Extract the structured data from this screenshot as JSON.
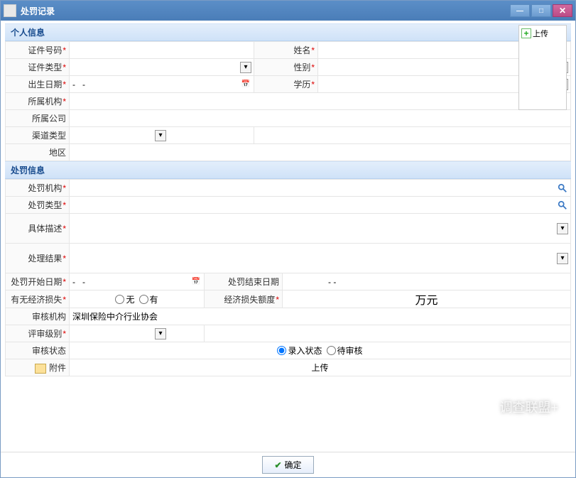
{
  "window": {
    "title": "处罚记录"
  },
  "sections": {
    "personal": "个人信息",
    "punish": "处罚信息"
  },
  "labels": {
    "idnum": "证件号码",
    "name": "姓名",
    "idtype": "证件类型",
    "gender": "性别",
    "dob": "出生日期",
    "edu": "学历",
    "org": "所属机构",
    "company": "所属公司",
    "channel": "渠道类型",
    "region": "地区",
    "punishOrg": "处罚机构",
    "punishType": "处罚类型",
    "desc": "具体描述",
    "result": "处理结果",
    "startDate": "处罚开始日期",
    "endDate": "处罚结束日期",
    "hasLoss": "有无经济损失",
    "lossAmt": "经济损失额度",
    "auditOrg": "审核机构",
    "auditLevel": "评审级别",
    "auditStatus": "审核状态",
    "attach": "附件"
  },
  "values": {
    "dob": "-   -",
    "startDate": "-   -",
    "endDate": "-   -",
    "auditOrg": "深圳保险中介行业协会",
    "lossUnit": "万元"
  },
  "radios": {
    "lossNone": "无",
    "lossHas": "有",
    "statusEntry": "录入状态",
    "statusPending": "待审核"
  },
  "buttons": {
    "upload": "上传",
    "uploadAction": "上传",
    "ok": "确定"
  },
  "watermark": "调查联盟+"
}
